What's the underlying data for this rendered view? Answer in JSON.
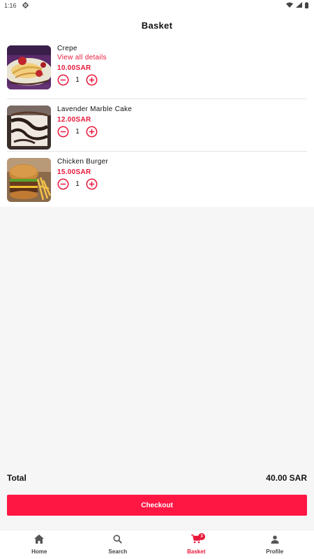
{
  "status_bar": {
    "time": "1:16",
    "icons": [
      "settings-gear-icon",
      "wifi-icon",
      "signal-icon",
      "battery-icon"
    ]
  },
  "header": {
    "title": "Basket"
  },
  "cart": {
    "items": [
      {
        "name": "Crepe",
        "details_link": "View all details",
        "price": "10.00SAR",
        "quantity": "1",
        "thumbnail": "crepe-photo"
      },
      {
        "name": "Lavender Marble Cake",
        "price": "12.00SAR",
        "quantity": "1",
        "thumbnail": "marble-cake-photo"
      },
      {
        "name": "Chicken Burger",
        "price": "15.00SAR",
        "quantity": "1",
        "thumbnail": "burger-photo"
      }
    ]
  },
  "summary": {
    "total_label": "Total",
    "total_value": "40.00 SAR"
  },
  "checkout": {
    "label": "Checkout"
  },
  "bottom_nav": {
    "items": [
      {
        "label": "Home",
        "icon": "home-icon"
      },
      {
        "label": "Search",
        "icon": "search-icon"
      },
      {
        "label": "Basket",
        "icon": "cart-icon",
        "badge": "3",
        "active": true
      },
      {
        "label": "Profile",
        "icon": "profile-icon"
      }
    ]
  },
  "colors": {
    "accent": "#e8173a",
    "button": "#ff1744",
    "background": "#f6f6f6"
  }
}
